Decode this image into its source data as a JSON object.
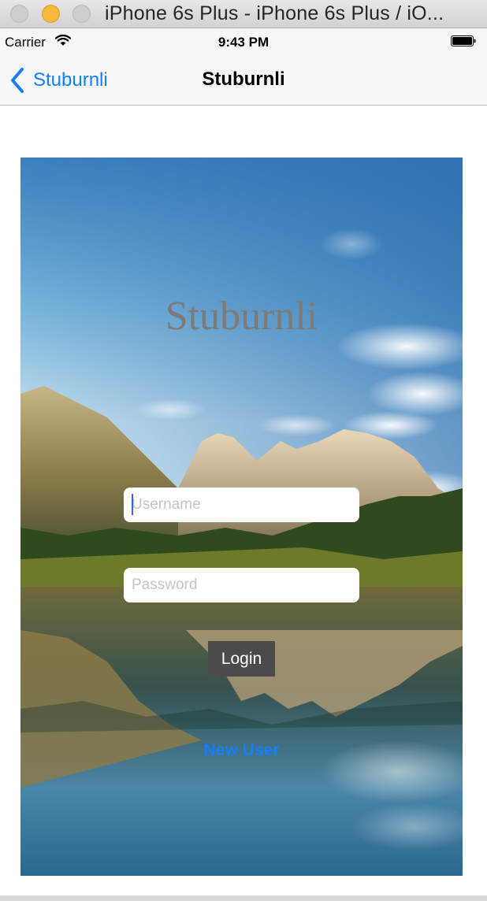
{
  "window": {
    "title": "iPhone 6s Plus - iPhone 6s Plus / iO..."
  },
  "status_bar": {
    "carrier": "Carrier",
    "time": "9:43 PM",
    "icons": [
      "wifi-icon",
      "battery-icon"
    ]
  },
  "nav": {
    "back_label": "Stuburnli",
    "title": "Stuburnli",
    "back_icon": "chevron-left-icon",
    "accent_color": "#147efb"
  },
  "login": {
    "app_title": "Stuburnli",
    "username_placeholder": "Username",
    "username_value": "",
    "password_placeholder": "Password",
    "password_value": "",
    "login_label": "Login",
    "new_user_label": "New User",
    "background_image": "mountain-lake-landscape"
  }
}
